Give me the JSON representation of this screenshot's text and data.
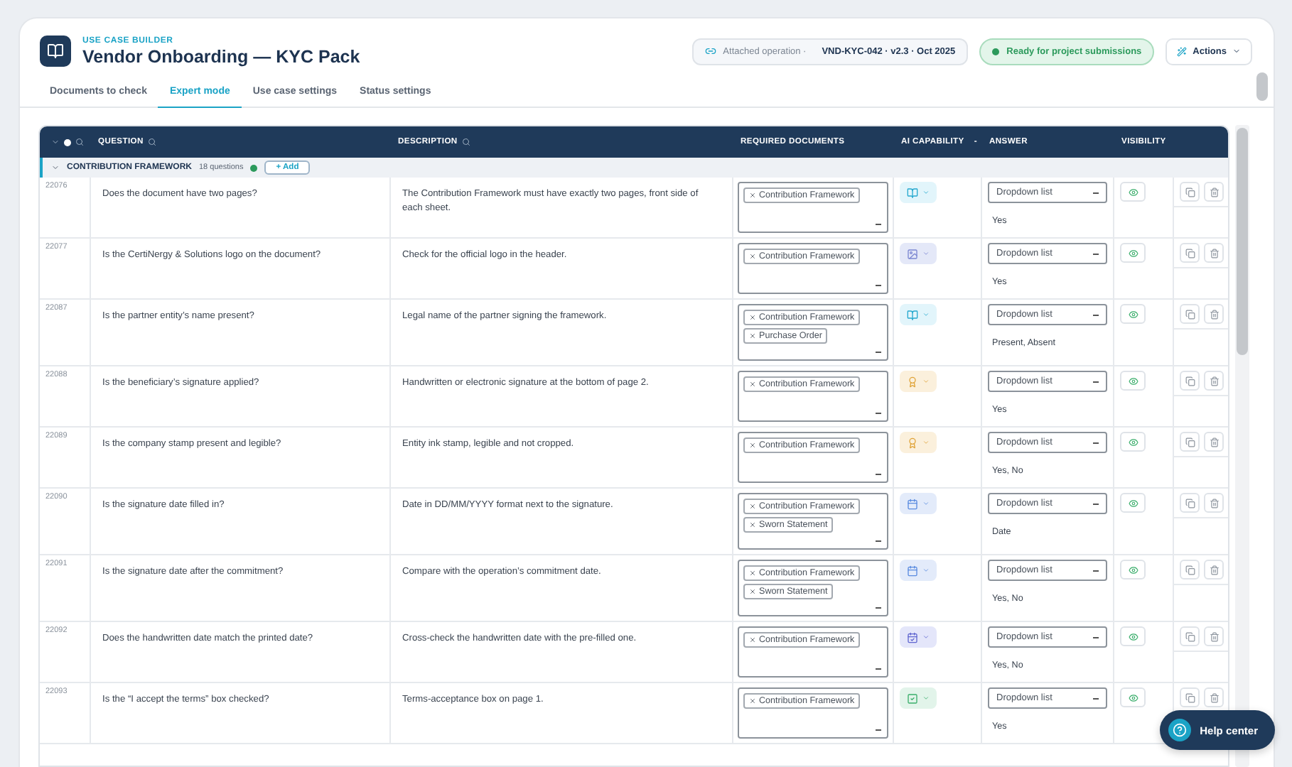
{
  "header": {
    "eyebrow": "USE CASE BUILDER",
    "title": "Vendor Onboarding — KYC Pack",
    "attached_label": "Attached operation ·",
    "attached_value": "VND-KYC-042 · v2.3 · Oct 2025",
    "status": "Ready for project submissions",
    "actions": "Actions"
  },
  "tabs": [
    {
      "label": "Documents to check",
      "selected": false
    },
    {
      "label": "Expert mode",
      "selected": true
    },
    {
      "label": "Use case settings",
      "selected": false
    },
    {
      "label": "Status settings",
      "selected": false
    }
  ],
  "table": {
    "columns": {
      "question": "QUESTION",
      "description": "DESCRIPTION",
      "required_documents": "REQUIRED DOCUMENTS",
      "ai_capability": "AI CAPABILITY",
      "ai_sort": "-",
      "answer": "ANSWER",
      "visibility": "VISIBILITY"
    },
    "group": {
      "name": "CONTRIBUTION FRAMEWORK",
      "count": "18 questions",
      "expanded": true,
      "add": "+ Add"
    },
    "rows": [
      {
        "id": "22076",
        "question": "Does the document have two pages?",
        "description": "The Contribution Framework must have exactly two pages, front side of each sheet.",
        "documents": [
          "Contribution Framework"
        ],
        "ai_capability": {
          "kind": "book"
        },
        "answer_type": "Dropdown list",
        "answer_values": "Yes"
      },
      {
        "id": "22077",
        "question": "Is the CertiNergy & Solutions logo on the document?",
        "description": "Check for the official logo in the header.",
        "documents": [
          "Contribution Framework"
        ],
        "ai_capability": {
          "kind": "image"
        },
        "answer_type": "Dropdown list",
        "answer_values": "Yes"
      },
      {
        "id": "22087",
        "question": "Is the partner entity’s name present?",
        "description": "Legal name of the partner signing the framework.",
        "documents": [
          "Contribution Framework",
          "Purchase Order"
        ],
        "ai_capability": {
          "kind": "book"
        },
        "answer_type": "Dropdown list",
        "answer_values": "Present, Absent"
      },
      {
        "id": "22088",
        "question": "Is the beneficiary’s signature applied?",
        "description": "Handwritten or electronic signature at the bottom of page 2.",
        "documents": [
          "Contribution Framework"
        ],
        "ai_capability": {
          "kind": "award"
        },
        "answer_type": "Dropdown list",
        "answer_values": "Yes"
      },
      {
        "id": "22089",
        "question": "Is the company stamp present and legible?",
        "description": "Entity ink stamp, legible and not cropped.",
        "documents": [
          "Contribution Framework"
        ],
        "ai_capability": {
          "kind": "award"
        },
        "answer_type": "Dropdown list",
        "answer_values": "Yes, No"
      },
      {
        "id": "22090",
        "question": "Is the signature date filled in?",
        "description": "Date in DD/MM/YYYY format next to the signature.",
        "documents": [
          "Contribution Framework",
          "Sworn Statement"
        ],
        "ai_capability": {
          "kind": "calendar"
        },
        "answer_type": "Dropdown list",
        "answer_values": "Date"
      },
      {
        "id": "22091",
        "question": "Is the signature date after the commitment?",
        "description": "Compare with the operation’s commitment date.",
        "documents": [
          "Contribution Framework",
          "Sworn Statement"
        ],
        "ai_capability": {
          "kind": "calendar"
        },
        "answer_type": "Dropdown list",
        "answer_values": "Yes, No"
      },
      {
        "id": "22092",
        "question": "Does the handwritten date match the printed date?",
        "description": "Cross-check the handwritten date with the pre-filled one.",
        "documents": [
          "Contribution Framework"
        ],
        "ai_capability": {
          "kind": "calendar-check"
        },
        "answer_type": "Dropdown list",
        "answer_values": "Yes, No"
      },
      {
        "id": "22093",
        "question": "Is the “I accept the terms” box checked?",
        "description": "Terms-acceptance box on page 1.",
        "documents": [
          "Contribution Framework"
        ],
        "ai_capability": {
          "kind": "checkbox"
        },
        "answer_type": "Dropdown list",
        "answer_values": "Yes"
      }
    ]
  },
  "help": "Help center"
}
